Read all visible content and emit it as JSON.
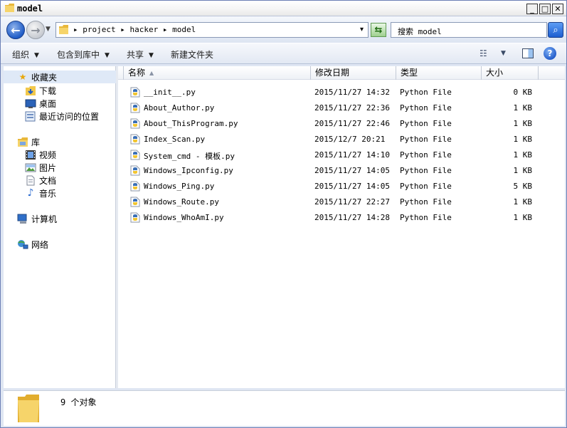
{
  "window": {
    "title": "model",
    "minimize": "_",
    "maximize": "□",
    "close": "✕"
  },
  "address": {
    "path": "▸ project ▸ hacker ▸ model",
    "dropdown": "▾"
  },
  "search": {
    "value": "搜索 model"
  },
  "toolbar": {
    "organize": "组织",
    "include_in_library": "包含到库中",
    "share": "共享",
    "new_folder": "新建文件夹"
  },
  "nav": {
    "favorites": {
      "label": "收藏夹",
      "items": [
        {
          "label": "下载",
          "icon": "download-folder-icon"
        },
        {
          "label": "桌面",
          "icon": "desktop-icon"
        },
        {
          "label": "最近访问的位置",
          "icon": "recent-places-icon"
        }
      ]
    },
    "libraries": {
      "label": "库",
      "items": [
        {
          "label": "视频",
          "icon": "video-icon"
        },
        {
          "label": "图片",
          "icon": "picture-icon"
        },
        {
          "label": "文档",
          "icon": "document-icon"
        },
        {
          "label": "音乐",
          "icon": "music-icon"
        }
      ]
    },
    "computer": {
      "label": "计算机"
    },
    "network": {
      "label": "网络"
    }
  },
  "columns": {
    "name": "名称",
    "modified": "修改日期",
    "type": "类型",
    "size": "大小"
  },
  "files": [
    {
      "name": "__init__.py",
      "modified": "2015/11/27 14:32",
      "type": "Python File",
      "size": "0 KB"
    },
    {
      "name": "About_Author.py",
      "modified": "2015/11/27 22:36",
      "type": "Python File",
      "size": "1 KB"
    },
    {
      "name": "About_ThisProgram.py",
      "modified": "2015/11/27 22:46",
      "type": "Python File",
      "size": "1 KB"
    },
    {
      "name": "Index_Scan.py",
      "modified": "2015/12/7 20:21",
      "type": "Python File",
      "size": "1 KB"
    },
    {
      "name": "System_cmd - 模板.py",
      "modified": "2015/11/27 14:10",
      "type": "Python File",
      "size": "1 KB"
    },
    {
      "name": "Windows_Ipconfig.py",
      "modified": "2015/11/27 14:05",
      "type": "Python File",
      "size": "1 KB"
    },
    {
      "name": "Windows_Ping.py",
      "modified": "2015/11/27 14:05",
      "type": "Python File",
      "size": "5 KB"
    },
    {
      "name": "Windows_Route.py",
      "modified": "2015/11/27 22:27",
      "type": "Python File",
      "size": "1 KB"
    },
    {
      "name": "Windows_WhoAmI.py",
      "modified": "2015/11/27 14:28",
      "type": "Python File",
      "size": "1 KB"
    }
  ],
  "details": {
    "count_text": "9 个对象"
  },
  "colors": {
    "accent": "#1f5cc7",
    "selection": "#dfe9f7",
    "folder": "#f2c84b"
  }
}
